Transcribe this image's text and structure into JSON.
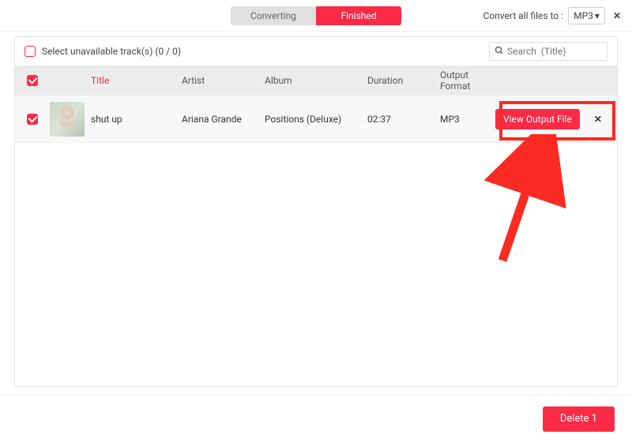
{
  "topbar": {
    "tabs": {
      "converting": "Converting",
      "finished": "Finished"
    },
    "convert_label": "Convert all files to :",
    "format_selected": "MP3"
  },
  "filter": {
    "select_unavailable": "Select unavailable track(s) (0 / 0)",
    "search_placeholder": "Search  (Title)"
  },
  "columns": {
    "title": "Title",
    "artist": "Artist",
    "album": "Album",
    "duration": "Duration",
    "output_format": "Output Format"
  },
  "rows": [
    {
      "title": "shut up",
      "artist": "Ariana Grande",
      "album": "Positions (Deluxe)",
      "duration": "02:37",
      "format": "MP3",
      "action_label": "View Output File"
    }
  ],
  "footer": {
    "delete_label": "Delete 1"
  }
}
